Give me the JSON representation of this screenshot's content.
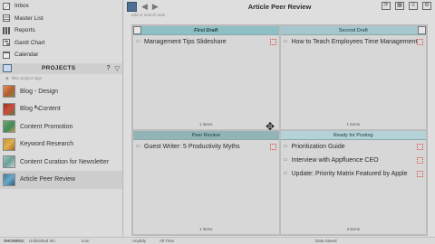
{
  "nav": {
    "items": [
      {
        "label": "Inbox",
        "icon": "envelope-icon"
      },
      {
        "label": "Master List",
        "icon": "list-icon"
      },
      {
        "label": "Reports",
        "icon": "bar-chart-icon"
      },
      {
        "label": "Gantt Chart",
        "icon": "gantt-icon"
      },
      {
        "label": "Calendar",
        "icon": "calendar-icon"
      }
    ]
  },
  "projects": {
    "header": "PROJECTS",
    "filter_placeholder": "filter project tags",
    "items": [
      {
        "label": "Blog - Design"
      },
      {
        "label": "Blog - Content"
      },
      {
        "label": "Content Promotion"
      },
      {
        "label": "Keyword Research"
      },
      {
        "label": "Content Curation for Newsletter"
      },
      {
        "label": "Article Peer Review"
      }
    ],
    "selected": "Article Peer Review"
  },
  "toolbar": {
    "title": "Article Peer Review",
    "add_task_placeholder": "add or search task"
  },
  "quadrants": [
    {
      "title": "First Draft",
      "tasks": [
        "Management Tips Slideshare"
      ],
      "count": "1 items"
    },
    {
      "title": "Second Draft",
      "tasks": [
        "How to Teach Employees Time Management"
      ],
      "count": "1 items"
    },
    {
      "title": "Peer Review",
      "tasks": [
        "Guest Writer: 5 Productivity Myths"
      ],
      "count": "1 items"
    },
    {
      "title": "Ready for Posting",
      "tasks": [
        "Prioritization Guide",
        "Interview with Appfluence CEO",
        "Update: Priority Matrix Featured by Apple"
      ],
      "count": "3 items"
    }
  ],
  "statusbar": {
    "showing_label": "SHOWING:",
    "filter1": "Unfinished Itm",
    "filter2": "Icon",
    "filter3": "Anybdy",
    "filter4": "All Time",
    "status": "Data Saved"
  },
  "colors": {
    "quadrant_header": "#8ebfc4",
    "flag": "#d9443a",
    "brand": "#4f6f92"
  }
}
